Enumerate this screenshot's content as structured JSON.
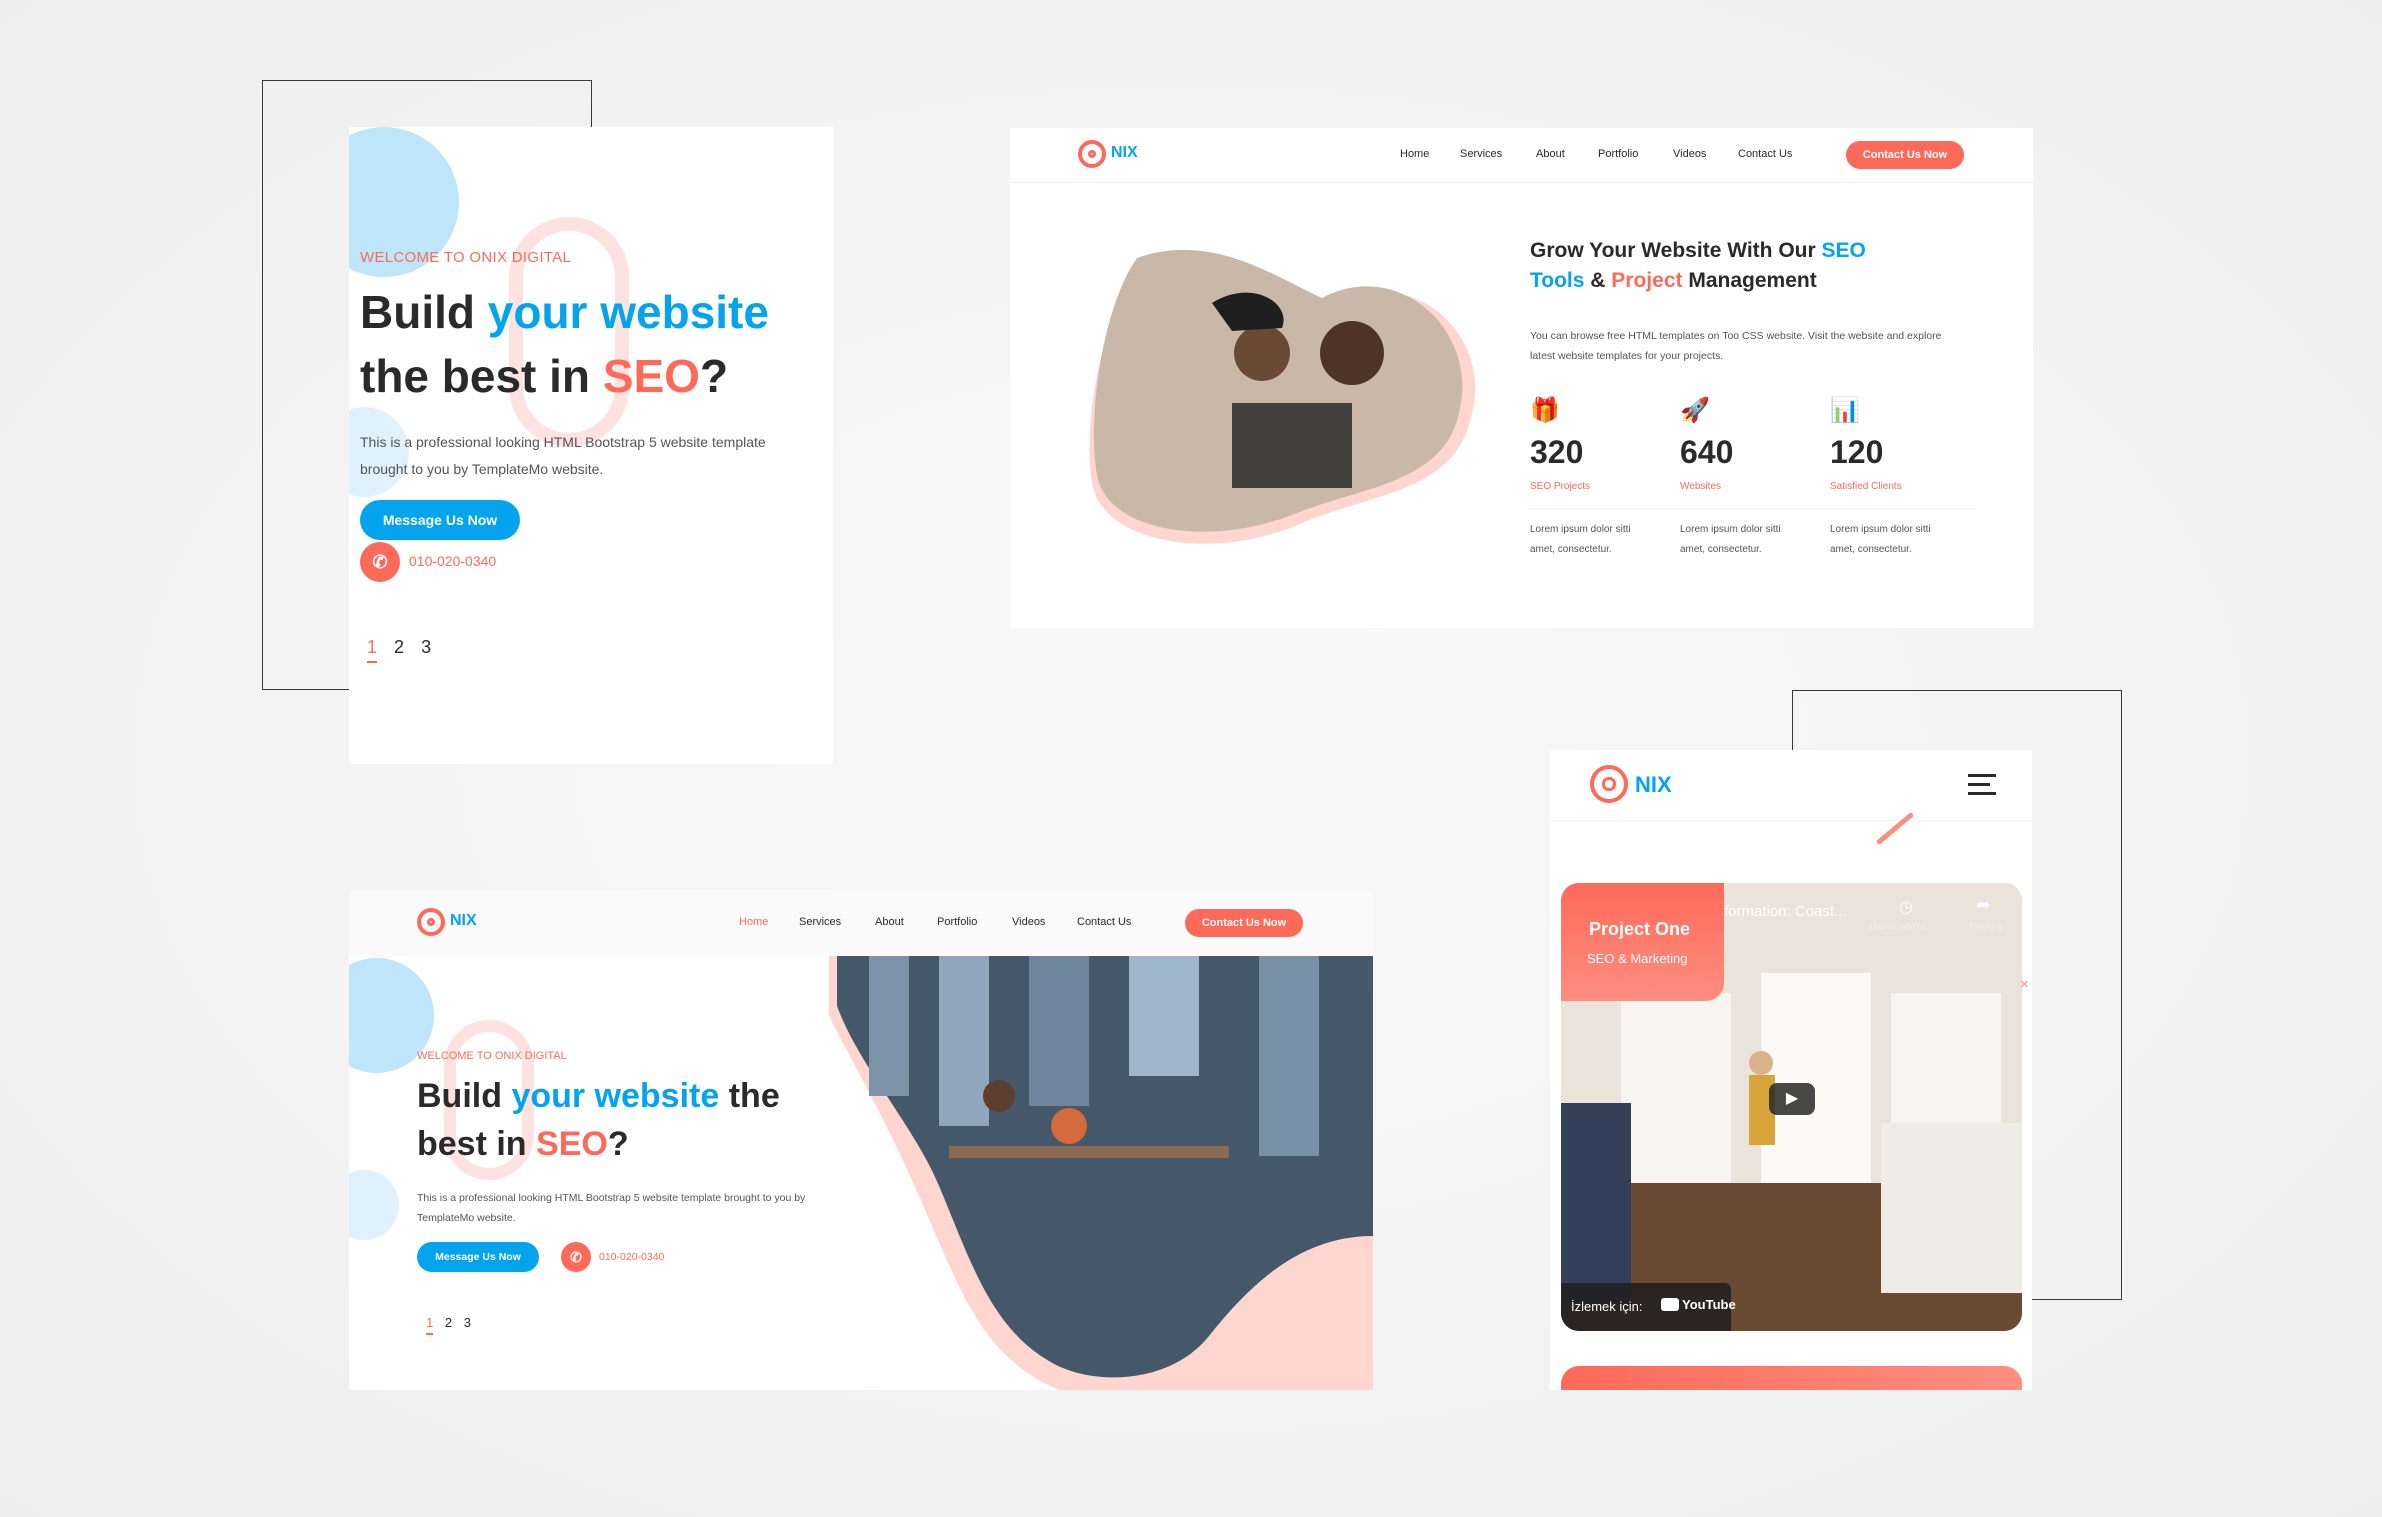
{
  "brand": {
    "logo_text": "NIX"
  },
  "colors": {
    "accent_blue": "#03a4ed",
    "accent_orange": "#fe6a59",
    "dark_text": "#2a2a2a"
  },
  "mobile_hero": {
    "eyebrow": "WELCOME TO ONIX DIGITAL",
    "title_part1": "Build ",
    "title_blue": "your website",
    "title_part2": "the best in ",
    "title_orange": "SEO",
    "title_end": "?",
    "description": "This is a professional looking HTML Bootstrap 5 website template brought to you by TemplateMo website.",
    "cta_label": "Message Us Now",
    "phone": "010-020-0340",
    "pagination": [
      "1",
      "2",
      "3"
    ]
  },
  "about_section": {
    "nav": [
      "Home",
      "Services",
      "About",
      "Portfolio",
      "Videos",
      "Contact Us"
    ],
    "contact_button": "Contact Us Now",
    "heading_part1": "Grow Your Website With Our ",
    "heading_blue1": "SEO",
    "heading_blue2": "Tools",
    "heading_amp": " & ",
    "heading_orange": "Project",
    "heading_part2": " Management",
    "description": "You can browse free HTML templates on Too CSS website. Visit the website and explore latest website templates for your projects.",
    "stats": [
      {
        "icon": "gift-icon",
        "value": "320",
        "label": "SEO Projects",
        "desc": "Lorem ipsum dolor sitti amet, consectetur."
      },
      {
        "icon": "rocket-icon",
        "value": "640",
        "label": "Websites",
        "desc": "Lorem ipsum dolor sitti amet, consectetur."
      },
      {
        "icon": "chart-icon",
        "value": "120",
        "label": "Satisfied Clients",
        "desc": "Lorem ipsum dolor sitti amet, consectetur."
      }
    ]
  },
  "desktop_hero": {
    "nav": [
      "Home",
      "Services",
      "About",
      "Portfolio",
      "Videos",
      "Contact Us"
    ],
    "contact_button": "Contact Us Now",
    "eyebrow": "WELCOME TO ONIX DIGITAL",
    "title_part1": "Build ",
    "title_blue": "your website",
    "title_part2": " the",
    "title_part3": "best in ",
    "title_orange": "SEO",
    "title_end": "?",
    "description": "This is a professional looking HTML Bootstrap 5 website template brought to you by TemplateMo website.",
    "cta_label": "Message Us Now",
    "phone": "010-020-0340",
    "pagination": [
      "1",
      "2",
      "3"
    ]
  },
  "mobile_video": {
    "project_title": "Project One",
    "project_subtitle": "SEO & Marketing",
    "video_title": "formation: Coast...",
    "watch_later": "Daha sonra...",
    "share": "Paylaş",
    "watch_on": "İzlemek için:",
    "youtube": "YouTube"
  }
}
